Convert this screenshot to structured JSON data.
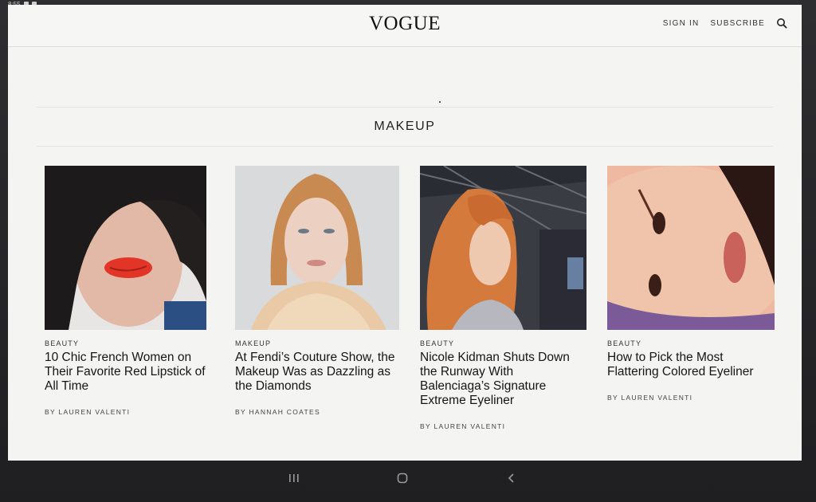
{
  "status": {
    "time": "8:55"
  },
  "header": {
    "logo": "VOGUE",
    "sign_in": "SIGN IN",
    "subscribe": "SUBSCRIBE",
    "search_icon": "search-icon"
  },
  "section": {
    "title": "MAKEUP"
  },
  "cards": [
    {
      "rubric": "BEAUTY",
      "title": "10 Chic French Women on Their Favorite Red Lipstick of All Time",
      "byline": "BY LAUREN VALENTI"
    },
    {
      "rubric": "MAKEUP",
      "title": "At Fendi’s Couture Show, the Makeup Was as Dazzling as the Diamonds",
      "byline": "BY HANNAH COATES"
    },
    {
      "rubric": "BEAUTY",
      "title": "Nicole Kidman Shuts Down the Runway With Balenciaga’s Signature Extreme Eyeliner",
      "byline": "BY LAUREN VALENTI"
    },
    {
      "rubric": "BEAUTY",
      "title": "How to Pick the Most Flattering Colored Eyeliner",
      "byline": "BY LAUREN VALENTI"
    }
  ],
  "system_nav": {
    "recents_icon": "recents-icon",
    "home_icon": "home-icon",
    "back_icon": "back-icon"
  },
  "colors": {
    "page_bg": "#f4f4f2",
    "text": "#151515",
    "bezel": "#2a2a2c"
  }
}
